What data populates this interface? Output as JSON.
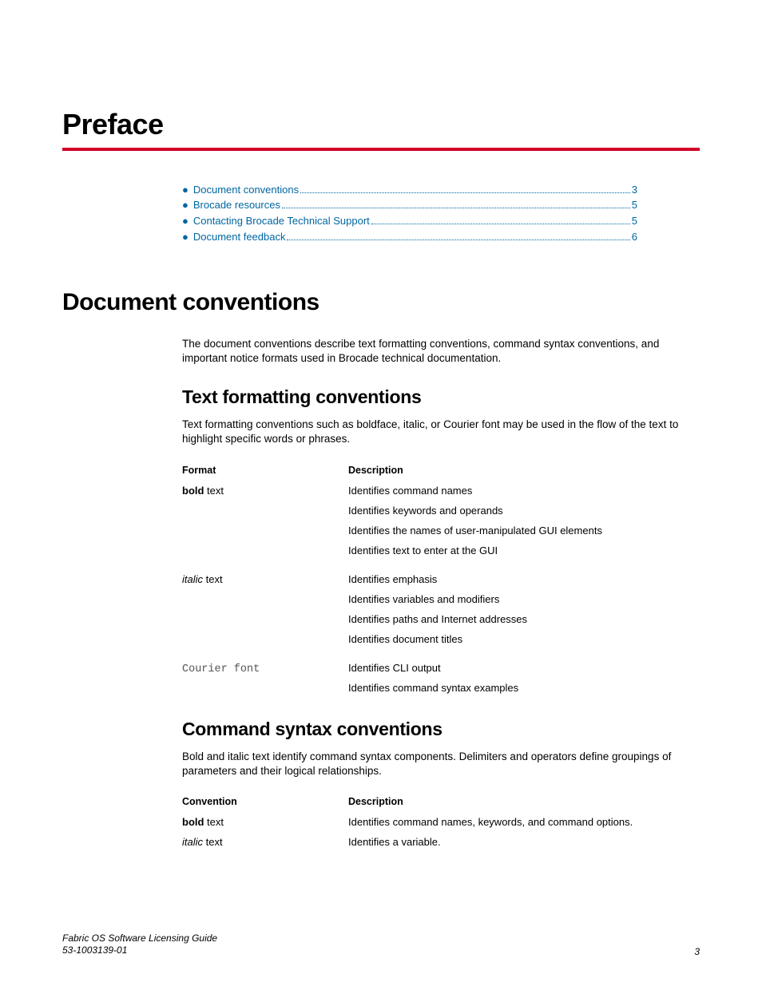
{
  "chapter_title": "Preface",
  "minitoc": [
    {
      "label": "Document conventions",
      "page": "3"
    },
    {
      "label": "Brocade resources",
      "page": "5"
    },
    {
      "label": "Contacting Brocade Technical Support",
      "page": "5"
    },
    {
      "label": "Document feedback",
      "page": "6"
    }
  ],
  "section1": {
    "heading": "Document conventions",
    "intro": "The document conventions describe text formatting conventions, command syntax conventions, and important notice formats used in Brocade technical documentation."
  },
  "text_formatting": {
    "heading": "Text formatting conventions",
    "intro": "Text formatting conventions such as boldface, italic, or Courier font may be used in the flow of the text to highlight specific words or phrases.",
    "th_format": "Format",
    "th_desc": "Description",
    "rows": {
      "bold": {
        "label_strong": "bold",
        "label_rest": " text",
        "lines": [
          "Identifies command names",
          "Identifies keywords and operands",
          "Identifies the names of user-manipulated GUI elements",
          "Identifies text to enter at the GUI"
        ]
      },
      "italic": {
        "label_em": "italic",
        "label_rest": " text",
        "lines": [
          "Identifies emphasis",
          "Identifies variables and modifiers",
          "Identifies paths and Internet addresses",
          "Identifies document titles"
        ]
      },
      "courier": {
        "label": "Courier font",
        "lines": [
          "Identifies CLI output",
          "Identifies command syntax examples"
        ]
      }
    }
  },
  "command_syntax": {
    "heading": "Command syntax conventions",
    "intro": "Bold and italic text identify command syntax components. Delimiters and operators define groupings of parameters and their logical relationships.",
    "th_conv": "Convention",
    "th_desc": "Description",
    "rows": {
      "bold": {
        "label_strong": "bold",
        "label_rest": " text",
        "desc": "Identifies command names, keywords, and command options."
      },
      "italic": {
        "label_em": "italic",
        "label_rest": " text",
        "desc": "Identifies a variable."
      }
    }
  },
  "footer": {
    "title": "Fabric OS Software Licensing Guide",
    "docnum": "53-1003139-01",
    "page": "3"
  }
}
